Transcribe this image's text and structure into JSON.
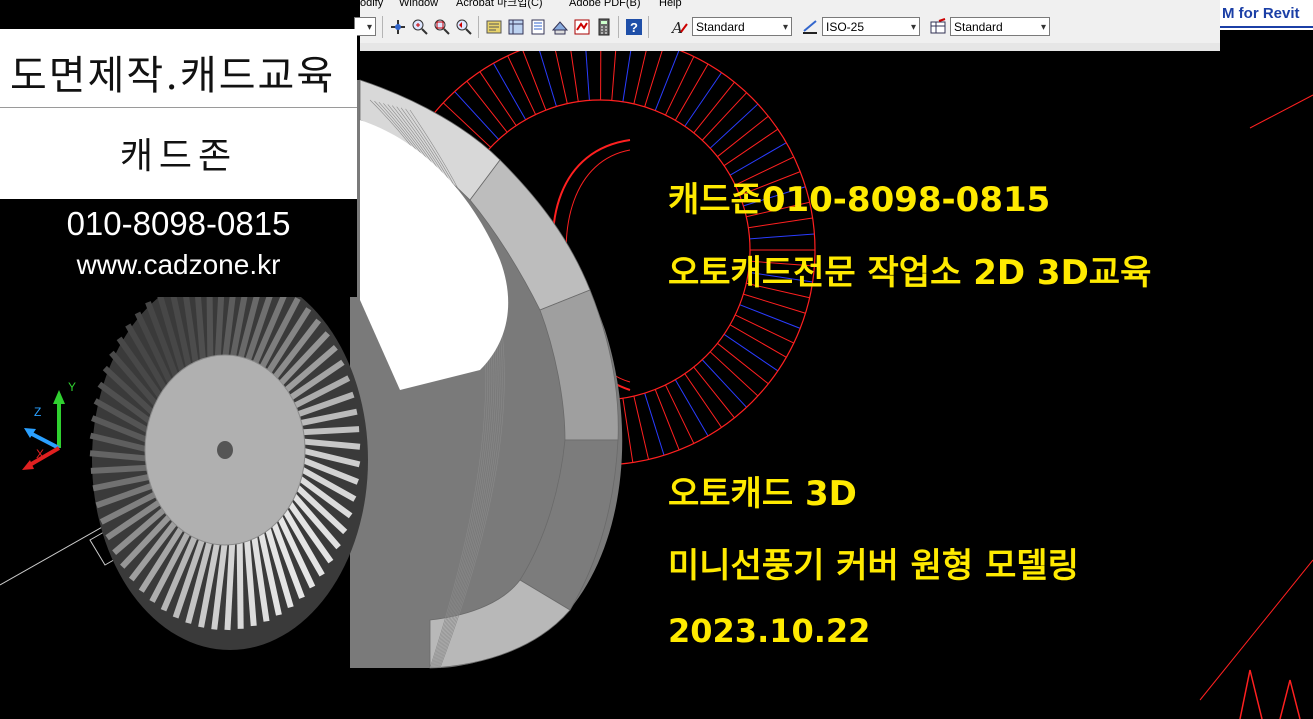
{
  "menu": {
    "items": [
      "odify",
      "Window",
      "Acrobat 마크업(C)",
      "Adobe PDF(B)",
      "Help"
    ]
  },
  "toolbar": {
    "text_style": "Standard",
    "dim_style": "ISO-25",
    "table_style": "Standard",
    "revit_label": "M for Revit"
  },
  "logo": {
    "line1": "도면제작.캐드교육",
    "line2": "캐드존",
    "phone": "010-8098-0815",
    "website": "www.cadzone.kr"
  },
  "overlay": {
    "line1": "캐드존010-8098-0815",
    "line2": "오토캐드전문 작업소 2D 3D교육",
    "line3": "오토캐드 3D",
    "line4": "미니선풍기 커버 원형 모델링",
    "date": "2023.10.22"
  },
  "ucs": {
    "y_label": "Y",
    "z_label": "Z",
    "x_label": "X"
  },
  "colors": {
    "overlay_text": "#ffea00",
    "wire_red": "#ff2020",
    "wire_blue": "#2a3cff",
    "background": "#000000"
  }
}
